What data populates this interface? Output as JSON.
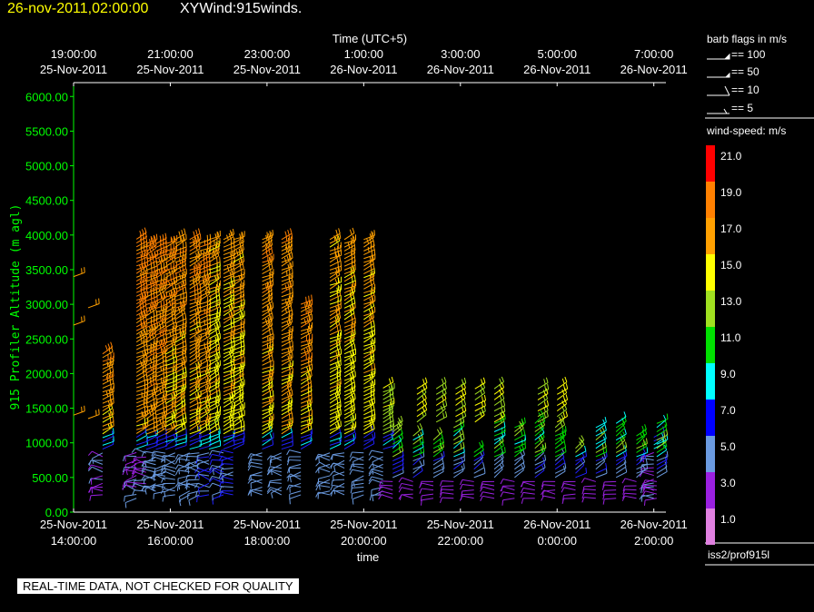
{
  "header": {
    "date_time": "26-nov-2011,02:00:00",
    "plot_title": "XYWind:915winds."
  },
  "disclaimer": "REAL-TIME DATA, NOT CHECKED FOR QUALITY",
  "source_label": "iss2/prof915l",
  "colors": {
    "date_time": "#ffff00",
    "y_axis": "#00ff00",
    "axes": "#ffffff"
  },
  "legend": {
    "flags_title": "barb flags in m/s",
    "flags": [
      "== 100",
      "== 50",
      "== 10",
      "== 5"
    ],
    "speed_title": "wind-speed: m/s",
    "speed_scale": [
      {
        "label": "21.0",
        "color": "#ff0000"
      },
      {
        "label": "19.0",
        "color": "#ff8000"
      },
      {
        "label": "17.0",
        "color": "#ffa000"
      },
      {
        "label": "15.0",
        "color": "#ffff00"
      },
      {
        "label": "13.0",
        "color": "#a0e020"
      },
      {
        "label": "11.0",
        "color": "#00e000"
      },
      {
        "label": "9.0",
        "color": "#00ffff"
      },
      {
        "label": "7.0",
        "color": "#0000ff"
      },
      {
        "label": "5.0",
        "color": "#6a9ae0"
      },
      {
        "label": "3.0",
        "color": "#9a20e0"
      },
      {
        "label": "1.0",
        "color": "#e080e0"
      }
    ]
  },
  "chart_data": {
    "type": "wind-barb time-height",
    "top_axis_title": "Time (UTC+5)",
    "top_ticks": [
      {
        "line1": "19:00:00",
        "line2": "25-Nov-2011"
      },
      {
        "line1": "21:00:00",
        "line2": "25-Nov-2011"
      },
      {
        "line1": "23:00:00",
        "line2": "25-Nov-2011"
      },
      {
        "line1": "1:00:00",
        "line2": "26-Nov-2011"
      },
      {
        "line1": "3:00:00",
        "line2": "26-Nov-2011"
      },
      {
        "line1": "5:00:00",
        "line2": "26-Nov-2011"
      },
      {
        "line1": "7:00:00",
        "line2": "26-Nov-2011"
      }
    ],
    "bottom_ticks": [
      {
        "line1": "25-Nov-2011",
        "line2": "14:00:00"
      },
      {
        "line1": "25-Nov-2011",
        "line2": "16:00:00"
      },
      {
        "line1": "25-Nov-2011",
        "line2": "18:00:00"
      },
      {
        "line1": "25-Nov-2011",
        "line2": "20:00:00"
      },
      {
        "line1": "25-Nov-2011",
        "line2": "22:00:00"
      },
      {
        "line1": "26-Nov-2011",
        "line2": "0:00:00"
      },
      {
        "line1": "26-Nov-2011",
        "line2": "2:00:00"
      }
    ],
    "xlabel": "time",
    "ylabel": "915 Profiler Altitude (m agl)",
    "x_range_hours": [
      14.0,
      26.25
    ],
    "ylim": [
      0,
      6200
    ],
    "y_ticks": [
      "0.00",
      "500.00",
      "1000.00",
      "1500.00",
      "2000.00",
      "2500.00",
      "3000.00",
      "3500.00",
      "4000.00",
      "4500.00",
      "5000.00",
      "5500.00",
      "6000.00"
    ],
    "series": [
      {
        "t": 14.0,
        "heights": [
          1400,
          2700,
          3400
        ],
        "speed": 17
      },
      {
        "t": 14.3,
        "heights": [
          1350,
          2950
        ],
        "speed": 17
      },
      {
        "t": 14.6,
        "levels": [
          250,
          2300
        ],
        "speed_low": 3,
        "speed_high": 17
      },
      {
        "t": 15.3,
        "levels": [
          200,
          3950
        ],
        "speed_low": 3,
        "speed_high": 18
      },
      {
        "t": 15.5,
        "levels": [
          300,
          3900
        ],
        "speed_low": 3,
        "speed_high": 18
      },
      {
        "t": 15.7,
        "levels": [
          300,
          3900
        ],
        "speed_low": 4,
        "speed_high": 18
      },
      {
        "t": 15.9,
        "levels": [
          300,
          3900
        ],
        "speed_low": 4,
        "speed_high": 17
      },
      {
        "t": 16.1,
        "levels": [
          250,
          3950
        ],
        "speed_low": 4,
        "speed_high": 17
      },
      {
        "t": 16.4,
        "levels": [
          250,
          3950
        ],
        "speed_low": 4,
        "speed_high": 17
      },
      {
        "t": 16.6,
        "levels": [
          250,
          3900
        ],
        "speed_low": 4,
        "speed_high": 17
      },
      {
        "t": 16.8,
        "levels": [
          250,
          3950
        ],
        "speed_low": 5,
        "speed_high": 16
      },
      {
        "t": 17.1,
        "levels": [
          250,
          3950
        ],
        "speed_low": 5,
        "speed_high": 16
      },
      {
        "t": 17.3,
        "levels": [
          250,
          3950
        ],
        "speed_low": 5,
        "speed_high": 16
      },
      {
        "t": 17.9,
        "levels": [
          250,
          3950
        ],
        "speed_low": 4,
        "speed_high": 17
      },
      {
        "t": 18.3,
        "levels": [
          250,
          3950
        ],
        "speed_low": 4,
        "speed_high": 17
      },
      {
        "t": 18.7,
        "levels": [
          250,
          3000
        ],
        "speed_low": 4,
        "speed_high": 17
      },
      {
        "t": 19.3,
        "levels": [
          250,
          3950
        ],
        "speed_low": 4,
        "speed_high": 16
      },
      {
        "t": 19.6,
        "levels": [
          250,
          3950
        ],
        "speed_low": 4,
        "speed_high": 16
      },
      {
        "t": 20.0,
        "levels": [
          250,
          3950
        ],
        "speed_low": 4,
        "speed_high": 16
      },
      {
        "t": 20.4,
        "levels": [
          250,
          1800
        ],
        "speed_low": 4,
        "speed_high": 13
      },
      {
        "t": 26.0,
        "levels": [
          200,
          1100
        ],
        "speed_low": 3,
        "speed_high": 7
      }
    ]
  }
}
